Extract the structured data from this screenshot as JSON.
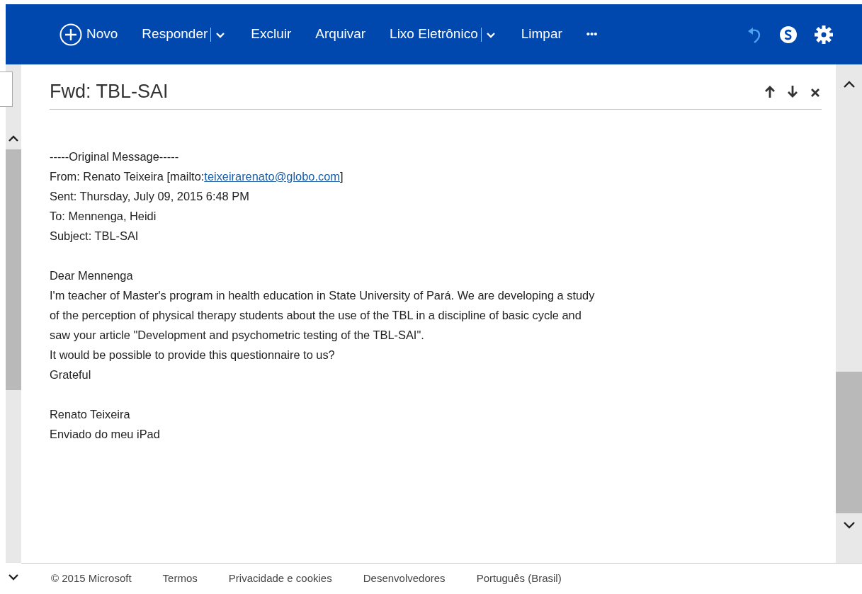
{
  "toolbar": {
    "items": [
      {
        "kind": "new",
        "label": "Novo"
      },
      {
        "kind": "split",
        "label": "Responder"
      },
      {
        "kind": "text",
        "label": "Excluir"
      },
      {
        "kind": "text",
        "label": "Arquivar"
      },
      {
        "kind": "split",
        "label": "Lixo Eletrônico"
      },
      {
        "kind": "text",
        "label": "Limpar"
      },
      {
        "kind": "more",
        "label": "•••"
      }
    ],
    "icons": [
      {
        "kind": "undo"
      },
      {
        "kind": "skype"
      },
      {
        "kind": "settings"
      }
    ]
  },
  "message": {
    "subject": "Fwd: TBL-SAI",
    "header_lines": [
      {
        "text": "-----Original Message-----"
      },
      {
        "text": "From: Renato Teixeira [mailto:",
        "link": "teixeirarenato@globo.com",
        "after": "]"
      },
      {
        "text": "Sent: Thursday, July 09, 2015 6:48 PM"
      },
      {
        "text": "To: Mennenga, Heidi"
      },
      {
        "text": "Subject: TBL-SAI"
      }
    ],
    "body_lines": [
      "Dear Mennenga",
      "I'm teacher of Master's program in health education in State University of Pará. We are developing a study",
      "of the perception of physical therapy students about the use of the TBL in a discipline of basic cycle and",
      "saw your article \"Development and psychometric testing of the TBL-SAI\".",
      "It would be possible to provide this questionnaire to us?",
      "Grateful"
    ],
    "signature_lines": [
      "Renato Teixeira",
      "Enviado do meu iPad"
    ]
  },
  "footer": {
    "copyright": "© 2015 Microsoft",
    "links": [
      "Termos",
      "Privacidade e cookies",
      "Desenvolvedores",
      "Português (Brasil)"
    ]
  }
}
